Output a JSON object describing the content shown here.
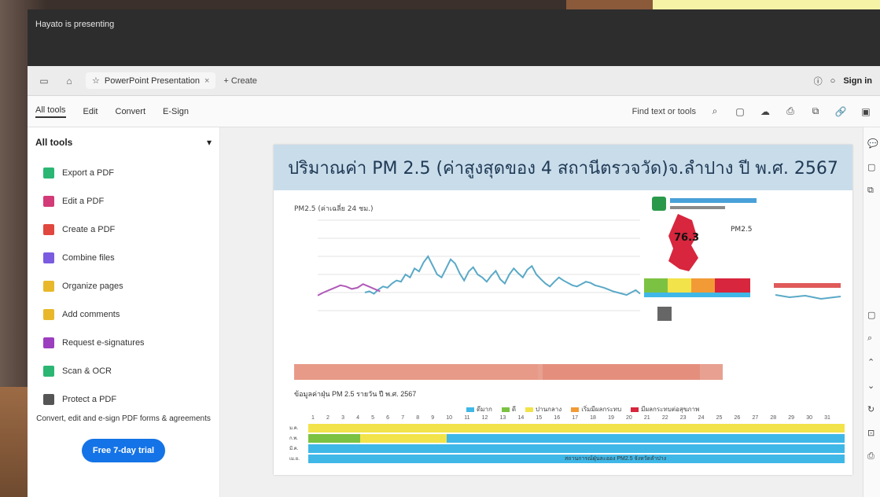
{
  "presenting": {
    "text": "Hayato is presenting"
  },
  "browser": {
    "tab_title": "PowerPoint Presentation",
    "tab_close": "×",
    "new_tab_label": "+ Create",
    "sign_in": "Sign in"
  },
  "toolbar": {
    "tabs": [
      "All tools",
      "Edit",
      "Convert",
      "E-Sign"
    ],
    "find": "Find text or tools"
  },
  "sidebar": {
    "title": "All tools",
    "collapse": "▾",
    "items": [
      {
        "label": "Export a PDF",
        "icon": "export-pdf-icon",
        "color": "#2bb673"
      },
      {
        "label": "Edit a PDF",
        "icon": "edit-pdf-icon",
        "color": "#d23a78"
      },
      {
        "label": "Create a PDF",
        "icon": "create-pdf-icon",
        "color": "#e0473e"
      },
      {
        "label": "Combine files",
        "icon": "combine-files-icon",
        "color": "#7b5be0"
      },
      {
        "label": "Organize pages",
        "icon": "organize-pages-icon",
        "color": "#e8b82a"
      },
      {
        "label": "Add comments",
        "icon": "add-comments-icon",
        "color": "#e8b82a"
      },
      {
        "label": "Request e-signatures",
        "icon": "request-esign-icon",
        "color": "#9b3fbf"
      },
      {
        "label": "Scan & OCR",
        "icon": "scan-ocr-icon",
        "color": "#2bb673"
      },
      {
        "label": "Protect a PDF",
        "icon": "protect-pdf-icon",
        "color": "#555555"
      }
    ],
    "promo": "Convert, edit and e-sign PDF forms & agreements",
    "trial_button": "Free 7-day trial"
  },
  "slide": {
    "title": "ปริมาณค่า PM 2.5 (ค่าสูงสุดของ 4 สถานีตรวจวัด)จ.ลำปาง ปี พ.ศ. 2567",
    "chart_subtitle": "PM2.5 (ค่าเฉลี่ย 24 ชม.)",
    "map_value": "76.3",
    "map_label": "PM2.5",
    "strip_left": "",
    "strip_right": "",
    "table_title": "ข้อมูลค่าฝุ่น PM 2.5 รายวัน ปี พ.ศ. 2567",
    "legend": [
      {
        "label": "ดีมาก",
        "color": "#3fb8e8"
      },
      {
        "label": "ดี",
        "color": "#7cc242"
      },
      {
        "label": "ปานกลาง",
        "color": "#f2e34a"
      },
      {
        "label": "เริ่มมีผลกระทบ",
        "color": "#f29b36"
      },
      {
        "label": "มีผลกระทบต่อสุขภาพ",
        "color": "#d7263d"
      }
    ],
    "days": [
      "1",
      "2",
      "3",
      "4",
      "5",
      "6",
      "7",
      "8",
      "9",
      "10",
      "11",
      "12",
      "13",
      "14",
      "15",
      "16",
      "17",
      "18",
      "19",
      "20",
      "21",
      "22",
      "23",
      "24",
      "25",
      "26",
      "27",
      "28",
      "29",
      "30",
      "31"
    ],
    "rows": [
      "ม.ค.",
      "ก.พ.",
      "มี.ค.",
      "เม.ย."
    ],
    "note": "สถานการณ์ฝุ่นละออง PM2.5 จังหวัดลำปาง"
  },
  "chart_data": {
    "type": "line",
    "title": "PM2.5 (ค่าเฉลี่ย 24 ชม.)",
    "xlabel": "",
    "ylabel": "",
    "ylim": [
      0,
      150
    ],
    "series": [
      {
        "name": "",
        "color": "#5aa9c7",
        "values": [
          30,
          32,
          28,
          35,
          40,
          38,
          45,
          50,
          48,
          60,
          55,
          70,
          65,
          80,
          90,
          75,
          60,
          55,
          70,
          85,
          78,
          62,
          50,
          65,
          72,
          60,
          55,
          48,
          58,
          66,
          52,
          45,
          60,
          70,
          62,
          55,
          68,
          74,
          60,
          52,
          45,
          40,
          48,
          55,
          50,
          46,
          42,
          40,
          44,
          48,
          46,
          42,
          40,
          38,
          35,
          32,
          30,
          28,
          26,
          30,
          34,
          28
        ]
      },
      {
        "name": "",
        "color": "#b05ab8",
        "values": [
          25,
          30,
          34,
          38,
          42,
          40,
          36,
          38,
          44,
          40,
          36,
          32
        ]
      }
    ]
  }
}
